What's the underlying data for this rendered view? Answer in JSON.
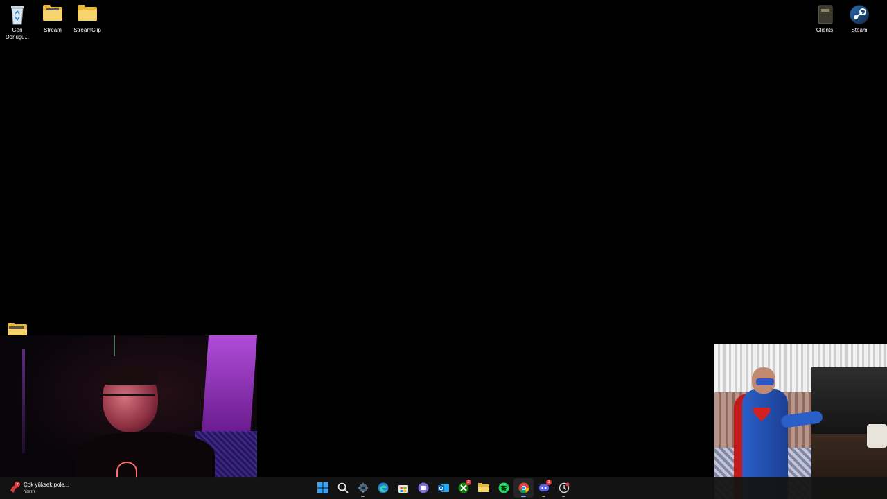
{
  "desktop": {
    "icons_left": [
      {
        "label": "Geri Dönüşü...",
        "icon": "recycle-bin-icon"
      },
      {
        "label": "Stream",
        "icon": "folder-icon"
      },
      {
        "label": "StreamClip",
        "icon": "folder-icon"
      }
    ],
    "icons_right": [
      {
        "label": "Clients",
        "icon": "book-icon"
      },
      {
        "label": "Steam",
        "icon": "steam-icon"
      }
    ]
  },
  "taskbar": {
    "weather": {
      "text": "Çok yüksek pole...",
      "subtext": "Yarın",
      "icon": "pollen-alert-icon",
      "badge": "7"
    },
    "apps": [
      {
        "name": "start",
        "icon": "windows-start-icon"
      },
      {
        "name": "search",
        "icon": "search-icon"
      },
      {
        "name": "app-3",
        "icon": "gear-app-icon"
      },
      {
        "name": "edge",
        "icon": "edge-icon"
      },
      {
        "name": "store",
        "icon": "store-icon"
      },
      {
        "name": "teams",
        "icon": "chat-icon"
      },
      {
        "name": "outlook",
        "icon": "outlook-icon"
      },
      {
        "name": "xbox",
        "icon": "xbox-icon",
        "badge": "2"
      },
      {
        "name": "explorer",
        "icon": "folder-icon"
      },
      {
        "name": "spotify",
        "icon": "spotify-icon"
      },
      {
        "name": "chrome",
        "icon": "chrome-icon"
      },
      {
        "name": "discord",
        "icon": "discord-icon",
        "badge": "1"
      },
      {
        "name": "app-13",
        "icon": "clock-app-icon"
      }
    ]
  },
  "colors": {
    "desktop_bg": "#000000",
    "taskbar_bg": "#141414",
    "folder": "#f7d36b",
    "badge": "#e0393e"
  }
}
